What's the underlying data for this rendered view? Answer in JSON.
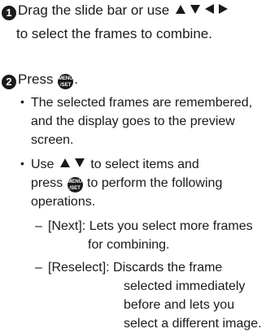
{
  "steps": [
    {
      "number": "1",
      "text_before_icons": "Drag the slide bar or use",
      "icons": [
        "triangle-up",
        "triangle-down",
        "triangle-left",
        "triangle-right"
      ],
      "text_line2": "to select the frames to combine."
    },
    {
      "number": "2",
      "text_before_icon": "Press",
      "icon": "menu-set-button",
      "text_after_icon": "."
    }
  ],
  "menu_button": {
    "line1": "MENU",
    "line2": "/SET"
  },
  "bullets": [
    {
      "lines": [
        "The selected frames are remembered,",
        "and the display goes to the preview",
        "screen."
      ]
    },
    {
      "line1_before": "Use",
      "line1_after": "to select items and",
      "line2_before": "press",
      "line2_after": "to perform the following",
      "line3": "operations."
    }
  ],
  "operations": [
    {
      "label": "[Next]:",
      "lines": [
        "Lets you select more frames",
        "for combining."
      ]
    },
    {
      "label": "[Reselect]:",
      "lines": [
        "Discards the frame",
        "selected immediately",
        "before and lets you",
        "select a different image."
      ]
    }
  ]
}
